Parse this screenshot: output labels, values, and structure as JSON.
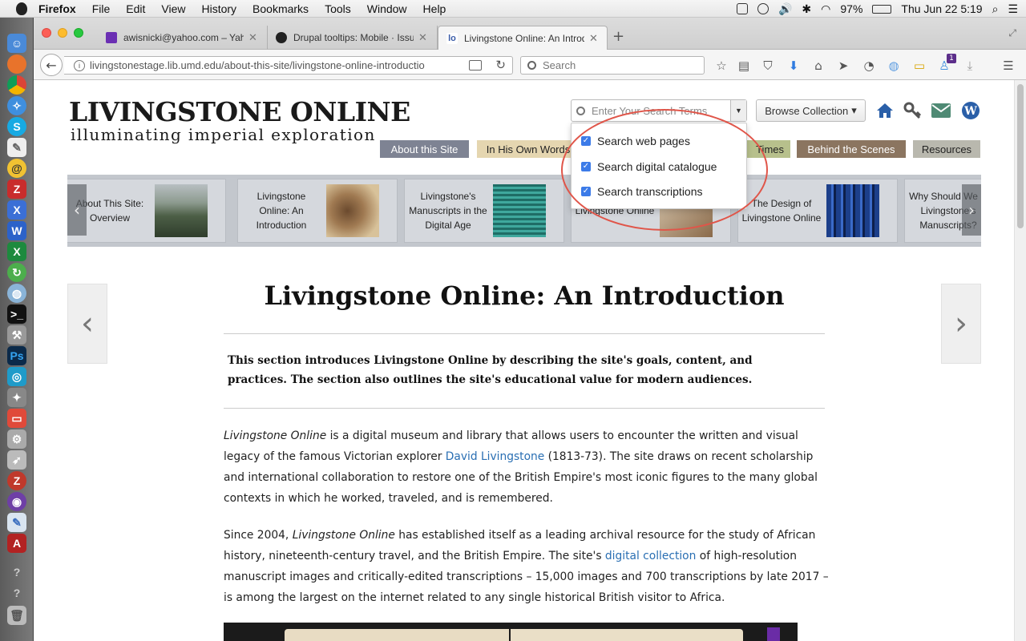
{
  "mac_menubar": {
    "app_name": "Firefox",
    "menus": [
      "File",
      "Edit",
      "View",
      "History",
      "Bookmarks",
      "Tools",
      "Window",
      "Help"
    ],
    "battery": "97%",
    "datetime": "Thu Jun 22  5:19"
  },
  "browser": {
    "tabs": [
      {
        "title": "awisnicki@yahoo.com – Yah",
        "active": false
      },
      {
        "title": "Drupal tooltips: Mobile · Issu",
        "active": false
      },
      {
        "title": "Livingstone Online: An Introd",
        "active": true
      }
    ],
    "url": "livingstonestage.lib.umd.edu/about-this-site/livingstone-online-introductio",
    "search_placeholder": "Search",
    "notification_badge": "1"
  },
  "site": {
    "logo_title": "LIVINGSTONE ONLINE",
    "logo_subtitle": "illuminating imperial exploration",
    "search_placeholder": "Enter Your Search Terms",
    "browse_label": "Browse Collection",
    "browse_caret": "▾",
    "nav_tabs": [
      {
        "label": "About this Site",
        "color": "#7e8393",
        "text_color": "#ffffff"
      },
      {
        "label": "In His Own Words",
        "color": "#e5d6b0",
        "text_color": "#222222"
      },
      {
        "label": "Times",
        "color": "#b7c08c",
        "text_color": "#222222"
      },
      {
        "label": "Behind the Scenes",
        "color": "#8b7560",
        "text_color": "#ffffff"
      },
      {
        "label": "Resources",
        "color": "#b9b8ae",
        "text_color": "#222222"
      }
    ],
    "search_dropdown": [
      "Search web pages",
      "Search digital catalogue",
      "Search transcriptions"
    ],
    "carousel": [
      {
        "title": "About This Site: Overview",
        "img": "landscape"
      },
      {
        "title": "Livingstone Online: An Introduction",
        "img": "drawing"
      },
      {
        "title": "Livingstone's Manuscripts in the Digital Age",
        "img": "spectral"
      },
      {
        "title": "Livingstone Online",
        "img": "people"
      },
      {
        "title": "The Design of Livingstone Online",
        "img": "stained-glass"
      },
      {
        "title": "Why Should We R Livingstone's Manuscripts?",
        "img": "none"
      }
    ]
  },
  "article": {
    "title": "Livingstone Online: An Introduction",
    "intro": "This section introduces Livingstone Online by describing the site's goals, content, and practices. The section also outlines the site's educational value for modern audiences.",
    "p1_em": "Livingstone Online",
    "p1_a": " is a digital museum and library that allows users to encounter the written and visual legacy of the famous Victorian explorer ",
    "p1_link": "David Livingstone",
    "p1_b": " (1813-73). The site draws on recent scholarship and international collaboration to restore one of the British Empire's most iconic figures to the many global contexts in which he worked, traveled, and is remembered.",
    "p2_a": "Since 2004, ",
    "p2_em": "Livingstone Online",
    "p2_b": " has established itself as a leading archival resource for the study of African history, nineteenth-century travel, and the British Empire. The site's ",
    "p2_link": "digital collection",
    "p2_c": " of high-resolution manuscript images and critically-edited transcriptions – 15,000 images and 700 transcriptions by late 2017 – is among the largest on the internet related to any single historical British visitor to Africa."
  }
}
